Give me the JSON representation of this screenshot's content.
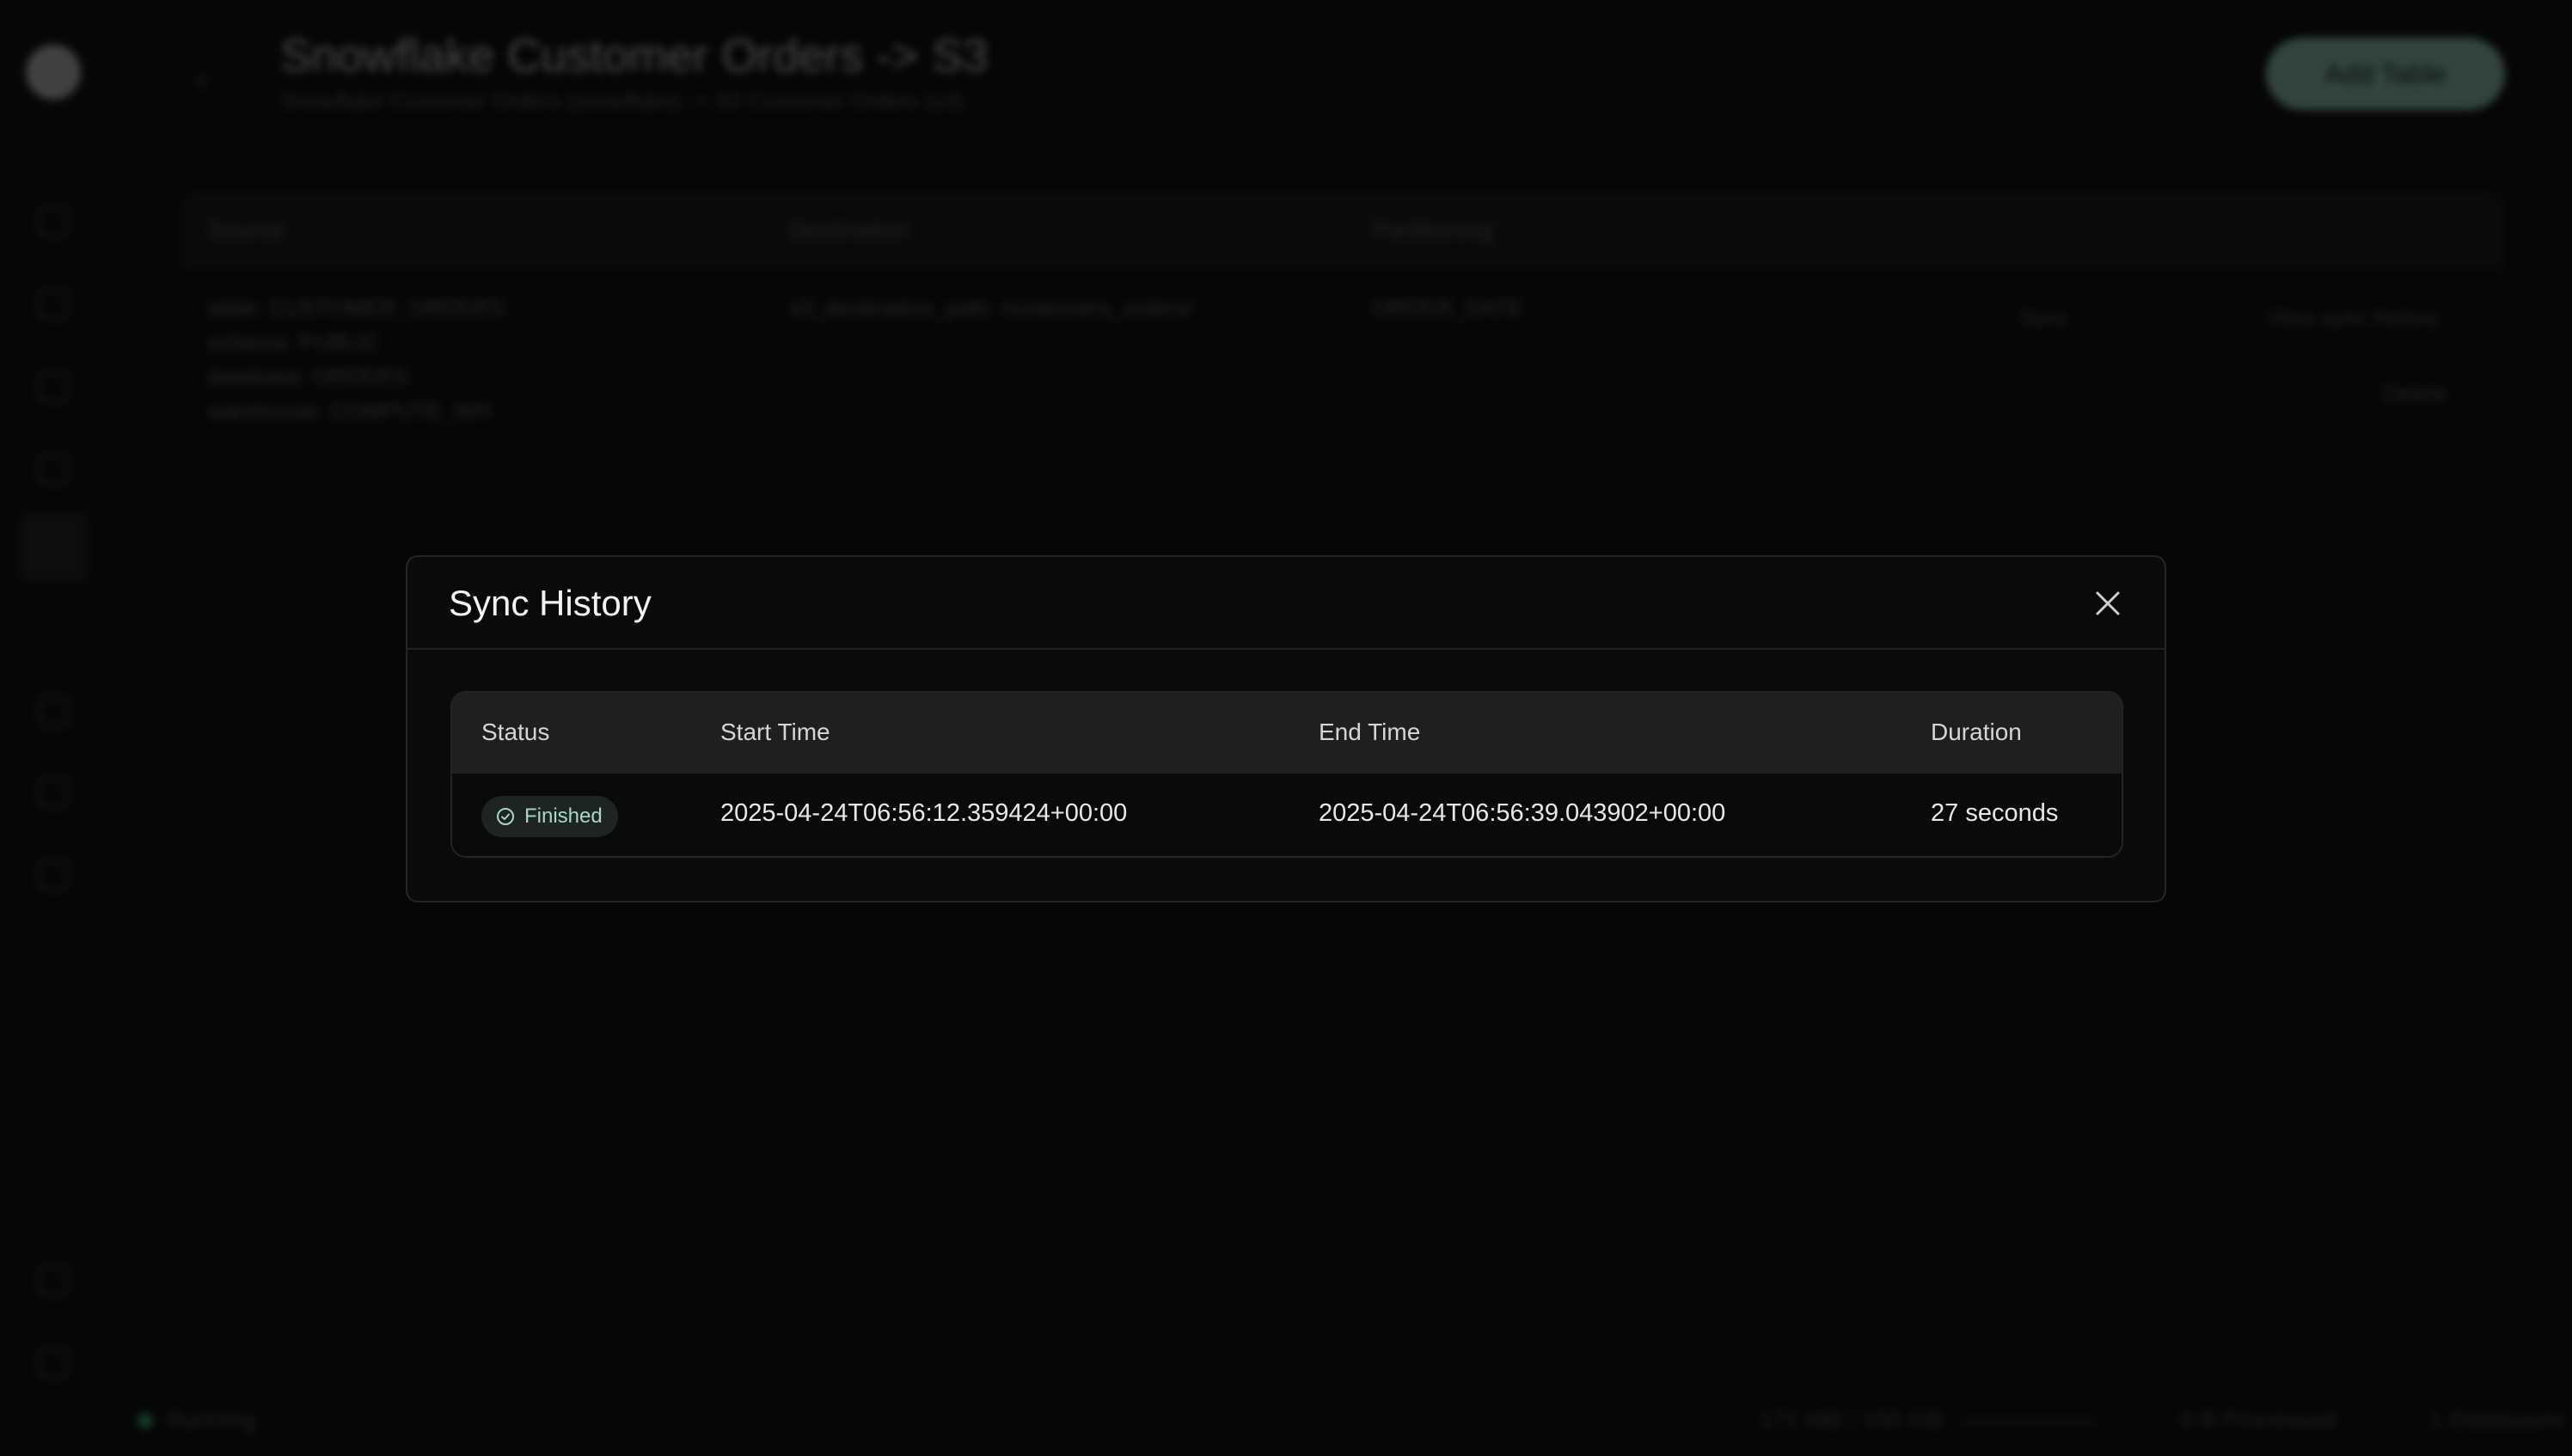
{
  "background": {
    "page_title": "Snowflake Customer Orders -> S3",
    "page_subtitle": "Snowflake Customer Orders (snowflake) -> S3 Customer Orders (s3)",
    "add_table_label": "Add Table",
    "table": {
      "headers": [
        "Source",
        "Destination",
        "Partitioning"
      ],
      "source_lines": [
        "table: CUSTOMER_ORDERS",
        "schema: PUBLIC",
        "database: ORDERS",
        "warehouse: COMPUTE_WH"
      ],
      "destination": "s3_destination_path: /customers_orders/",
      "partitioning": "ORDER_DATE",
      "sync_label": "Sync",
      "view_history_label": "View sync history",
      "delete_label": "Delete"
    },
    "status_bar": {
      "running": "Running",
      "memory": "171 MB / 150 GB",
      "processed": "0 B Processed",
      "databases": "1 Databases"
    }
  },
  "modal": {
    "title": "Sync History",
    "columns": {
      "status": "Status",
      "start_time": "Start Time",
      "end_time": "End Time",
      "duration": "Duration"
    },
    "rows": [
      {
        "status": "Finished",
        "start_time": "2025-04-24T06:56:12.359424+00:00",
        "end_time": "2025-04-24T06:56:39.043902+00:00",
        "duration": "27 seconds"
      }
    ]
  },
  "colors": {
    "accent": "#9fd9c1",
    "success": "#a8d8c3",
    "running": "#3fbf80"
  }
}
